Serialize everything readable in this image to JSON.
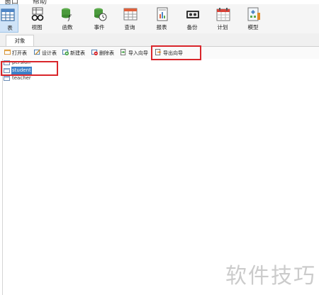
{
  "menubar": {
    "items": [
      "窗口",
      "帮助"
    ]
  },
  "toolbar": {
    "buttons": [
      {
        "label": "表",
        "icon": "table-icon"
      },
      {
        "label": "视图",
        "icon": "view-glasses-icon"
      },
      {
        "label": "函数",
        "icon": "function-icon"
      },
      {
        "label": "事件",
        "icon": "event-icon"
      },
      {
        "label": "查询",
        "icon": "query-icon"
      },
      {
        "label": "报表",
        "icon": "report-icon"
      },
      {
        "label": "备份",
        "icon": "backup-icon"
      },
      {
        "label": "计划",
        "icon": "schedule-icon"
      },
      {
        "label": "模型",
        "icon": "model-icon"
      }
    ],
    "active": "表"
  },
  "tabs": {
    "objects": "对象"
  },
  "object_toolbar": {
    "open_table": "打开表",
    "design_table": "设计表",
    "new_table": "新建表",
    "delete_table": "删除表",
    "import_wizard": "导入向导",
    "export_wizard": "导出向导"
  },
  "tables": [
    {
      "name": "persion",
      "selected": false
    },
    {
      "name": "student",
      "selected": true
    },
    {
      "name": "teacher",
      "selected": false
    }
  ],
  "colors": {
    "highlight": "#d9262b",
    "selection": "#3e81c8",
    "active_tool": "#cfe3f7"
  },
  "watermark": "软件技巧"
}
